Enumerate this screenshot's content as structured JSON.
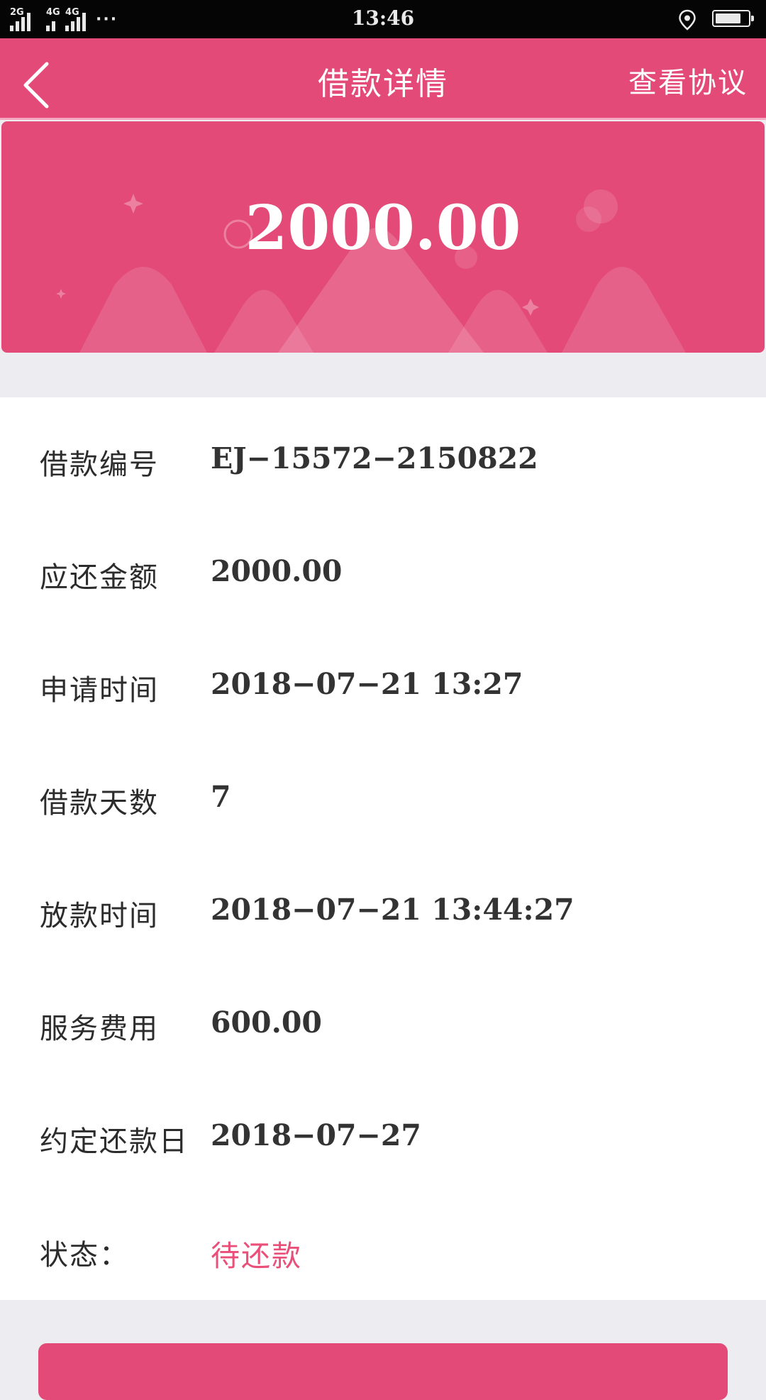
{
  "status_bar": {
    "network1": "2G",
    "network2": "4G",
    "network3": "4G",
    "more": "···",
    "time": "13:46",
    "battery_level": 0.8
  },
  "nav": {
    "title": "借款详情",
    "right_link": "查看协议"
  },
  "hero": {
    "amount": "2000.00"
  },
  "details": [
    {
      "label": "借款编号",
      "value": "EJ−15572−2150822"
    },
    {
      "label": "应还金额",
      "value": "2000.00"
    },
    {
      "label": "申请时间",
      "value": "2018−07−21 13:27"
    },
    {
      "label": "借款天数",
      "value": "7"
    },
    {
      "label": "放款时间",
      "value": "2018−07−21 13:44:27"
    },
    {
      "label": "服务费用",
      "value": "600.00"
    },
    {
      "label": "约定还款日",
      "value": "2018−07−27"
    },
    {
      "label": "状态：",
      "value": "待还款"
    }
  ],
  "colors": {
    "brand": "#e34a78",
    "status_text": "#ea4f7a",
    "background": "#ececf1"
  },
  "icons": {
    "back": "chevron-left-icon",
    "location": "location-pin-icon",
    "battery": "battery-icon"
  }
}
